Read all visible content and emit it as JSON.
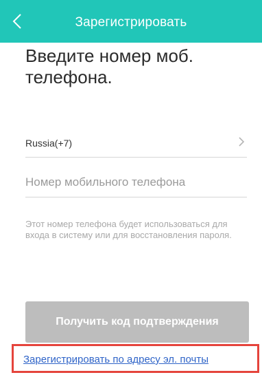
{
  "header": {
    "title": "Зарегистрировать",
    "back_icon": "chevron-left-icon"
  },
  "form": {
    "heading": "Введите номер моб. телефона.",
    "country": "Russia(+7)",
    "country_chevron_icon": "chevron-right-icon",
    "phone_placeholder": "Номер мобильного телефона",
    "phone_value": "",
    "hint": "Этот номер телефона будет использоваться для входа в систему или для восстановления пароля.",
    "get_code_label": "Получить код подтверждения",
    "email_link": "Зарегистрировать по адресу эл. почты"
  },
  "colors": {
    "header_bg": "#21c6b8",
    "button_disabled": "#bdbdbd",
    "link": "#2f64c8",
    "highlight_frame": "#e5443c"
  }
}
